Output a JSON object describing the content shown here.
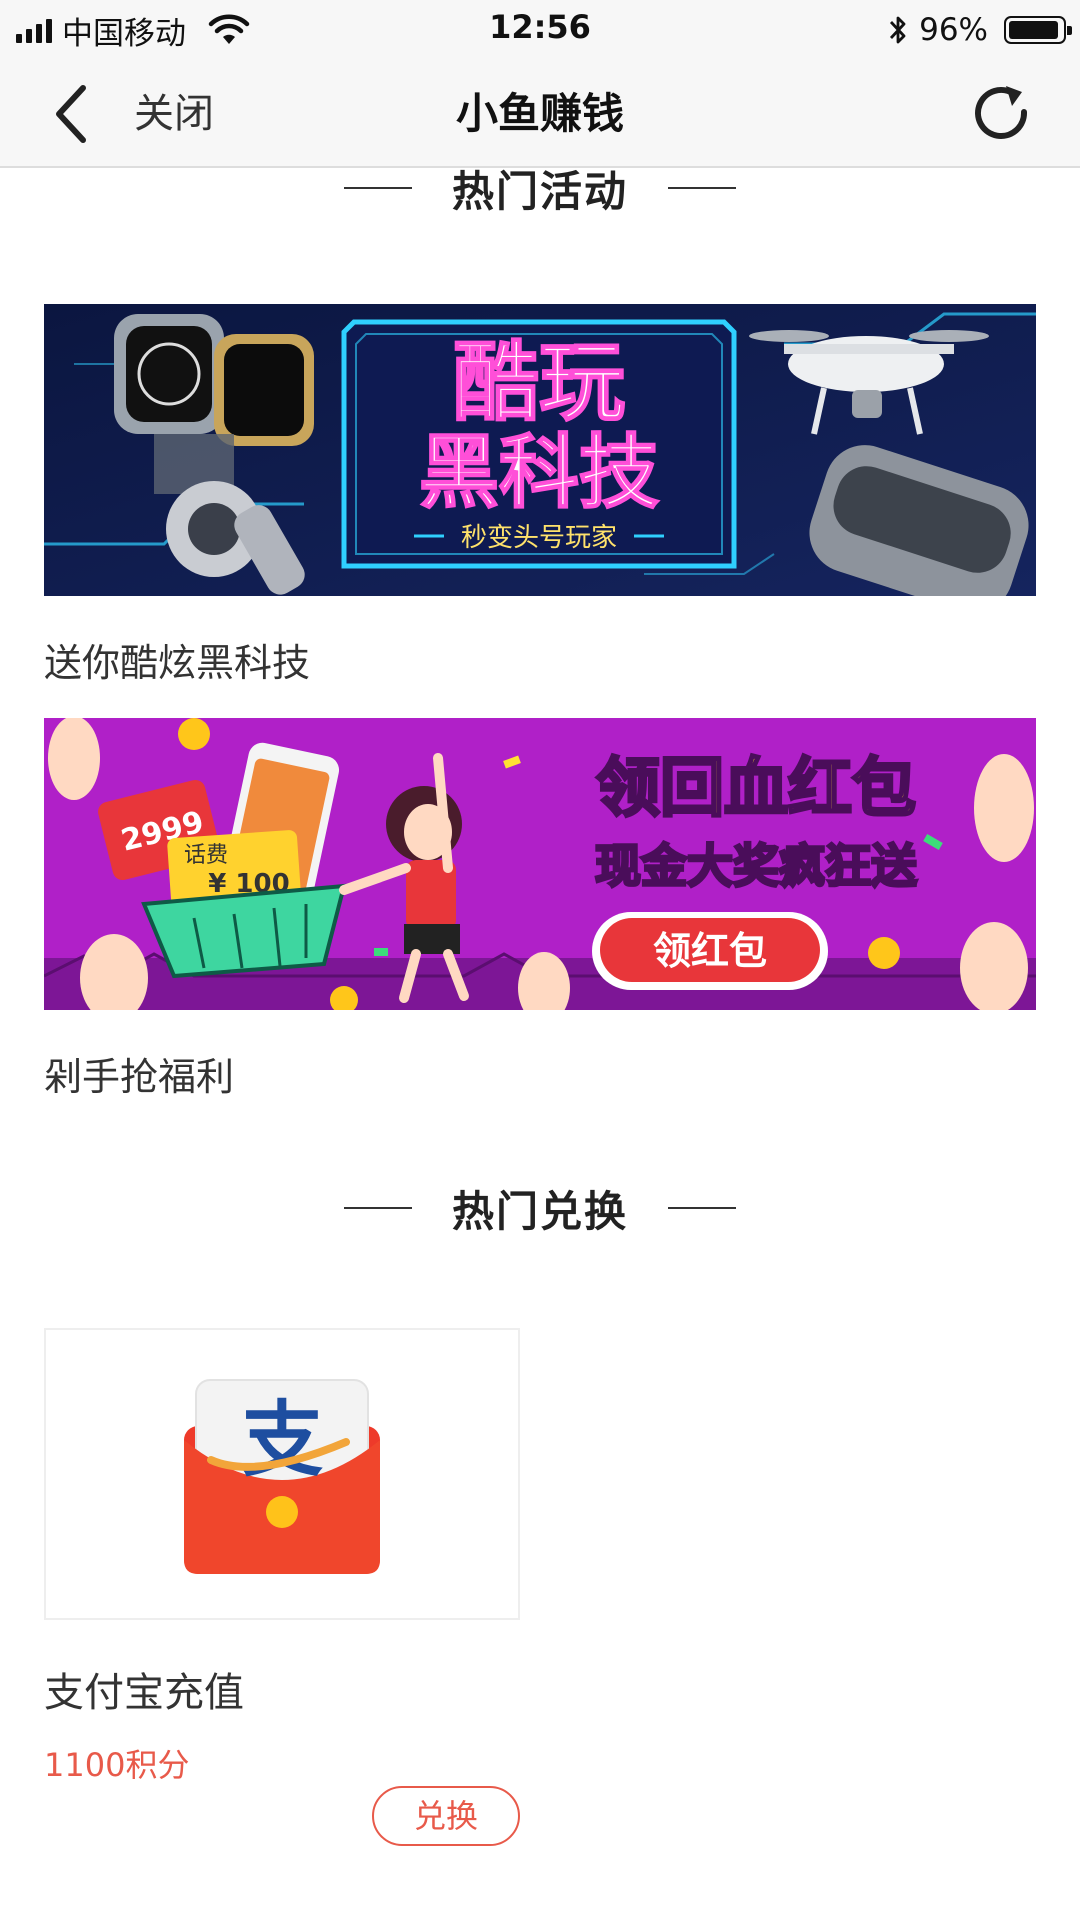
{
  "status_bar": {
    "carrier": "中国移动",
    "time": "12:56",
    "battery_percent": "96%",
    "battery_level": 0.96,
    "signal_bars": 4,
    "icons": [
      "signal-icon",
      "wifi-icon",
      "bluetooth-icon",
      "battery-icon"
    ]
  },
  "nav": {
    "back_icon": "chevron-left-icon",
    "close_label": "关闭",
    "title": "小鱼赚钱",
    "refresh_icon": "refresh-icon"
  },
  "sections": {
    "hot_activities": "热门活动",
    "hot_exchange": "热门兑换"
  },
  "activities": [
    {
      "caption": "送你酷炫黑科技",
      "banner": {
        "title_line1": "酷玩",
        "title_line2": "黑科技",
        "subtitle": "秒变头号玩家",
        "colors": {
          "bg": "#0d1b4a",
          "frame": "#2fd0ff",
          "accent": "#ff4fd8"
        }
      }
    },
    {
      "caption": "剁手抢福利",
      "banner": {
        "title_line1": "领回血红包",
        "title_line2": "现金大奖疯狂送",
        "button_label": "领红包",
        "price_tag": "2999",
        "voucher_label": "话费",
        "voucher_value": "¥ 100",
        "colors": {
          "bg": "#b020c8",
          "title": "#ffe033",
          "button": "#e8363a"
        }
      }
    }
  ],
  "exchange": {
    "items": [
      {
        "name": "支付宝充值",
        "points": "1100积分",
        "button_label": "兑换",
        "icon": "alipay-red-envelope-icon",
        "icon_glyph": "支"
      }
    ]
  },
  "colors": {
    "accent": "#e85a4a",
    "bar_bg": "#f7f7f7",
    "text": "#222222"
  }
}
